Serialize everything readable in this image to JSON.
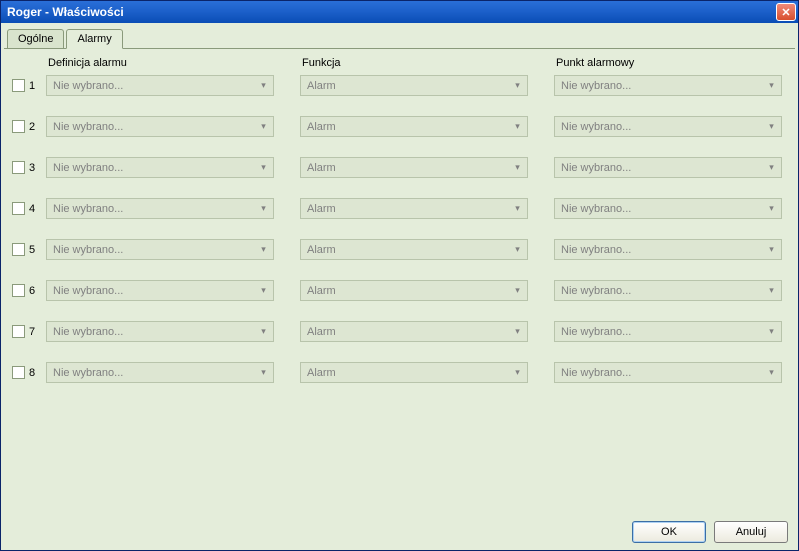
{
  "window": {
    "title": "Roger - Właściwości"
  },
  "tabs": {
    "general": "Ogólne",
    "alarms": "Alarmy"
  },
  "headers": {
    "def": "Definicja alarmu",
    "fun": "Funkcja",
    "pkt": "Punkt alarmowy"
  },
  "rows": [
    {
      "num": "1",
      "def": "Nie wybrano...",
      "fun": "Alarm",
      "pkt": "Nie wybrano..."
    },
    {
      "num": "2",
      "def": "Nie wybrano...",
      "fun": "Alarm",
      "pkt": "Nie wybrano..."
    },
    {
      "num": "3",
      "def": "Nie wybrano...",
      "fun": "Alarm",
      "pkt": "Nie wybrano..."
    },
    {
      "num": "4",
      "def": "Nie wybrano...",
      "fun": "Alarm",
      "pkt": "Nie wybrano..."
    },
    {
      "num": "5",
      "def": "Nie wybrano...",
      "fun": "Alarm",
      "pkt": "Nie wybrano..."
    },
    {
      "num": "6",
      "def": "Nie wybrano...",
      "fun": "Alarm",
      "pkt": "Nie wybrano..."
    },
    {
      "num": "7",
      "def": "Nie wybrano...",
      "fun": "Alarm",
      "pkt": "Nie wybrano..."
    },
    {
      "num": "8",
      "def": "Nie wybrano...",
      "fun": "Alarm",
      "pkt": "Nie wybrano..."
    }
  ],
  "buttons": {
    "ok": "OK",
    "cancel": "Anuluj"
  },
  "icons": {
    "close": "✕",
    "arrow": "▾"
  }
}
